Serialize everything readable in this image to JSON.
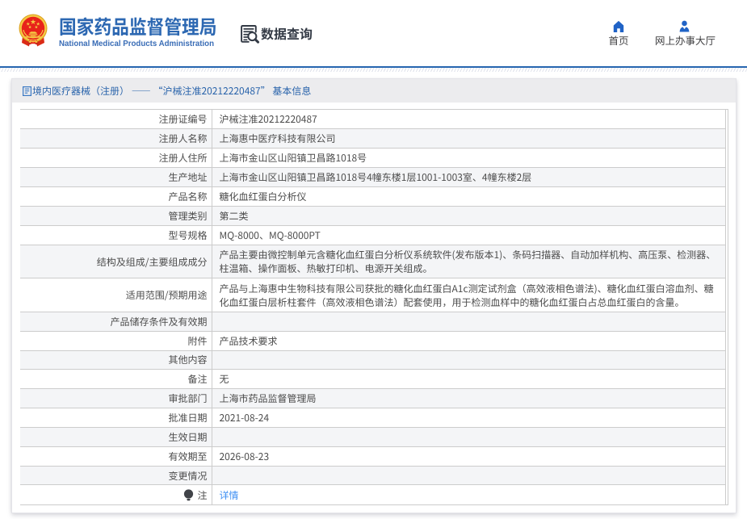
{
  "header": {
    "org_name_cn": "国家药品监督管理局",
    "org_name_en": "National Medical Products Administration",
    "section_title": "数据查询",
    "section_icon": "document-search-icon",
    "nav": [
      {
        "label": "首页",
        "icon": "home-icon"
      },
      {
        "label": "网上办事大厅",
        "icon": "user-icon"
      }
    ]
  },
  "breadcrumb": {
    "icon": "document-icon",
    "category": "境内医疗器械（注册）",
    "separator": "——",
    "current": "“沪械注准20212220487” 基本信息"
  },
  "table": {
    "rows": [
      {
        "label": "注册证编号",
        "value": "沪械注准20212220487"
      },
      {
        "label": "注册人名称",
        "value": "上海惠中医疗科技有限公司"
      },
      {
        "label": "注册人住所",
        "value": "上海市金山区山阳镇卫昌路1018号"
      },
      {
        "label": "生产地址",
        "value": "上海市金山区山阳镇卫昌路1018号4幢东楼1层1001-1003室、4幢东楼2层"
      },
      {
        "label": "产品名称",
        "value": "糖化血红蛋白分析仪"
      },
      {
        "label": "管理类别",
        "value": "第二类"
      },
      {
        "label": "型号规格",
        "value": "MQ-8000、MQ-8000PT"
      },
      {
        "label": "结构及组成/主要组成成分",
        "value": "产品主要由微控制单元含糖化血红蛋白分析仪系统软件(发布版本1)、条码扫描器、自动加样机构、高压泵、检测器、柱温箱、操作面板、热敏打印机、电源开关组成。",
        "lines": 2
      },
      {
        "label": "适用范围/预期用途",
        "value": "产品与上海惠中生物科技有限公司获批的糖化血红蛋白A1c测定试剂盒（高效液相色谱法)、糖化血红蛋白溶血剂、糖化血红蛋白层析柱套件（高效液相色谱法）配套使用，用于检测血样中的糖化血红蛋白占总血红蛋白的含量。",
        "lines": 2
      },
      {
        "label": "产品储存条件及有效期",
        "value": ""
      },
      {
        "label": "附件",
        "value": "产品技术要求"
      },
      {
        "label": "其他内容",
        "value": ""
      },
      {
        "label": "备注",
        "value": "无"
      },
      {
        "label": "审批部门",
        "value": "上海市药品监督管理局"
      },
      {
        "label": "批准日期",
        "value": "2021-08-24"
      },
      {
        "label": "生效日期",
        "value": ""
      },
      {
        "label": "有效期至",
        "value": "2026-08-23"
      },
      {
        "label": "变更情况",
        "value": ""
      },
      {
        "label": "注",
        "value": "详情",
        "link": true,
        "note_icon": "lightbulb-icon"
      }
    ]
  },
  "colors": {
    "brand_blue": "#2d68b2",
    "nav_icon_blue": "#2063c6",
    "link_blue": "#3e8ff3",
    "breadcrumb_blue": "#2a64ab",
    "header_rule_blue": "#2766b0",
    "row_stripe": "#f4f5f7",
    "table_border": "#cccccc",
    "emblem_red": "#de2910",
    "emblem_gold": "#f3c545"
  }
}
